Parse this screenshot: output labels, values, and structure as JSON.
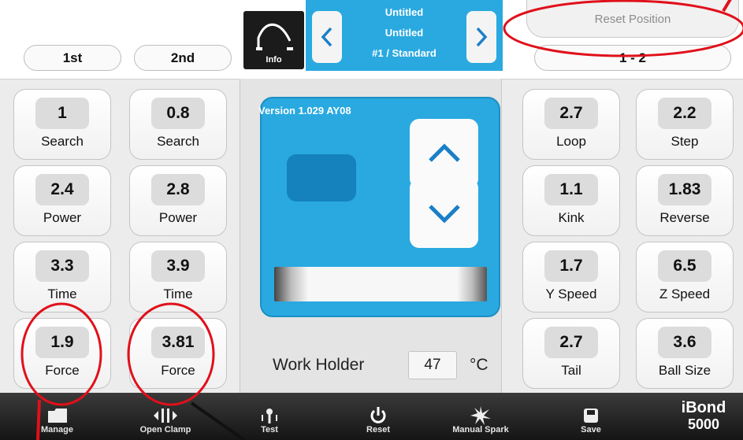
{
  "top": {
    "tab1": "1st",
    "tab2": "2nd",
    "info_label": "Info",
    "program": {
      "line1": "Untitled",
      "line2": "Untitled",
      "line3": "#1 / Standard"
    },
    "reset_position": "Reset Position",
    "step_indicator": "1 - 2"
  },
  "left_col1": [
    {
      "value": "1",
      "label": "Search"
    },
    {
      "value": "2.4",
      "label": "Power"
    },
    {
      "value": "3.3",
      "label": "Time"
    },
    {
      "value": "1.9",
      "label": "Force"
    }
  ],
  "left_col2": [
    {
      "value": "0.8",
      "label": "Search"
    },
    {
      "value": "2.8",
      "label": "Power"
    },
    {
      "value": "3.9",
      "label": "Time"
    },
    {
      "value": "3.81",
      "label": "Force"
    }
  ],
  "right_col1": [
    {
      "value": "2.7",
      "label": "Loop"
    },
    {
      "value": "1.1",
      "label": "Kink"
    },
    {
      "value": "1.7",
      "label": "Y Speed"
    },
    {
      "value": "2.7",
      "label": "Tail"
    }
  ],
  "right_col2": [
    {
      "value": "2.2",
      "label": "Step"
    },
    {
      "value": "1.83",
      "label": "Reverse"
    },
    {
      "value": "6.5",
      "label": "Z Speed"
    },
    {
      "value": "3.6",
      "label": "Ball Size"
    }
  ],
  "center": {
    "version": "Version 1.029 AY08",
    "work_holder_label": "Work Holder",
    "work_holder_value": "47",
    "work_holder_unit": "°C"
  },
  "bottom_bar": {
    "items": [
      "Manage",
      "Open Clamp",
      "Test",
      "Reset",
      "Manual Spark",
      "Save"
    ],
    "brand_line1": "iBond",
    "brand_line2": "5000"
  },
  "colors": {
    "accent_blue": "#29a9e0",
    "annotation_red": "#e0101a",
    "bottom_bar": "#1f1f1f"
  }
}
